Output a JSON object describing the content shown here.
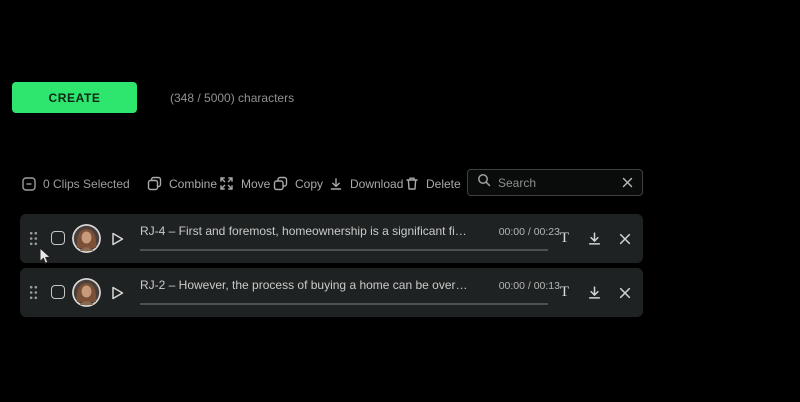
{
  "header": {
    "create_label": "CREATE",
    "char_counter": "(348 / 5000) characters"
  },
  "toolbar": {
    "clips_selected_label": "0 Clips Selected",
    "actions": [
      {
        "id": "combine",
        "label": "Combine"
      },
      {
        "id": "move",
        "label": "Move"
      },
      {
        "id": "copy",
        "label": "Copy"
      },
      {
        "id": "download",
        "label": "Download"
      },
      {
        "id": "delete",
        "label": "Delete"
      }
    ],
    "search": {
      "placeholder": "Search"
    }
  },
  "clips": [
    {
      "title": "RJ-4  –  First and foremost, homeownership is a significant fi…",
      "time": "00:00 / 00:23"
    },
    {
      "title": "RJ-2  –  However, the process of buying a home can be over…",
      "time": "00:00 / 00:13"
    }
  ],
  "icons": {
    "clips_selected": "indeterminate-checkbox-icon",
    "combine": "overlapping-squares-icon",
    "move": "expand-arrows-icon",
    "copy": "copy-icon",
    "download": "download-arrow-icon",
    "delete": "trash-icon",
    "search": "magnifier-icon",
    "clear_search": "x-icon",
    "drag": "drag-dots-icon",
    "play": "play-triangle-icon",
    "text_edit": "serif-t-icon",
    "remove_clip": "x-icon"
  },
  "colors": {
    "accent_green": "#2ee56e",
    "page_bg": "#000000",
    "row_bg": "#1f2222",
    "seek_line": "#4d504e"
  }
}
